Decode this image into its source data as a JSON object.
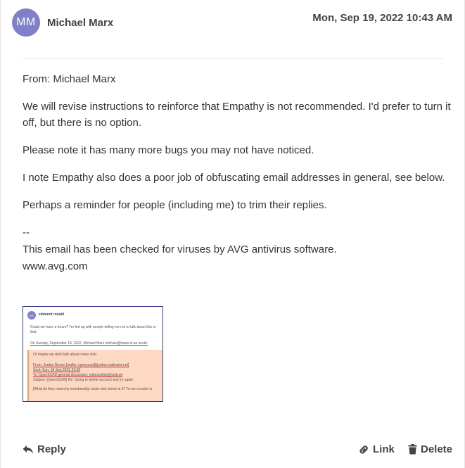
{
  "message": {
    "avatar_initials": "MM",
    "author": "Michael Marx",
    "timestamp": "Mon, Sep 19, 2022 10:43 AM",
    "body": {
      "from_line": "From: Michael Marx",
      "p1": "We will revise instructions to reinforce that Empathy is not recommended. I'd prefer to turn it off, but there is no option.",
      "p2": "Please note it has many more bugs you may not have noticed.",
      "p3": "I note Empathy also does a poor job of obfuscating email addresses in general, see below.",
      "p4": "Perhaps a reminder for people (including me) to trim their replies.",
      "sig_sep": "--",
      "sig_line1": "This email has been checked for viruses by AVG antivirus software.",
      "sig_line2": "www.avg.com"
    },
    "attachment": {
      "avatar_initials": "ER",
      "name": "edmund ronald",
      "line1": "Could we have a forum? I'm fed up with people telling me not to talk about this or that.",
      "line2": "On Sunday, September 18, 2022, Michael Marx michael@marx.id.au wrote:",
      "quote1": "Or maybe we don't talk about roster-club.",
      "quote_from": "From: Jordan Brown [mailto: openscad@jordan.maileater.net]",
      "quote_sent": "Sent: Sun, 18 Sep 2022 23:58",
      "quote_to": "To: OpenSCAD general discussion; mikesonline@web.de",
      "quote_subject": "Subject: [OpenSCAD] Re: Going to delete account and try again",
      "quote_tail": "[What do they mean by membership roster and where is it? To me a roster is"
    }
  },
  "actions": {
    "reply": "Reply",
    "link": "Link",
    "delete": "Delete"
  },
  "icons": {
    "reply": "reply-arrow-icon",
    "link": "link-chain-icon",
    "delete": "trash-icon"
  },
  "colors": {
    "avatar": "#8080c8",
    "quote_bg": "#fdd8c2",
    "thumb_border": "#3b3b8c"
  }
}
